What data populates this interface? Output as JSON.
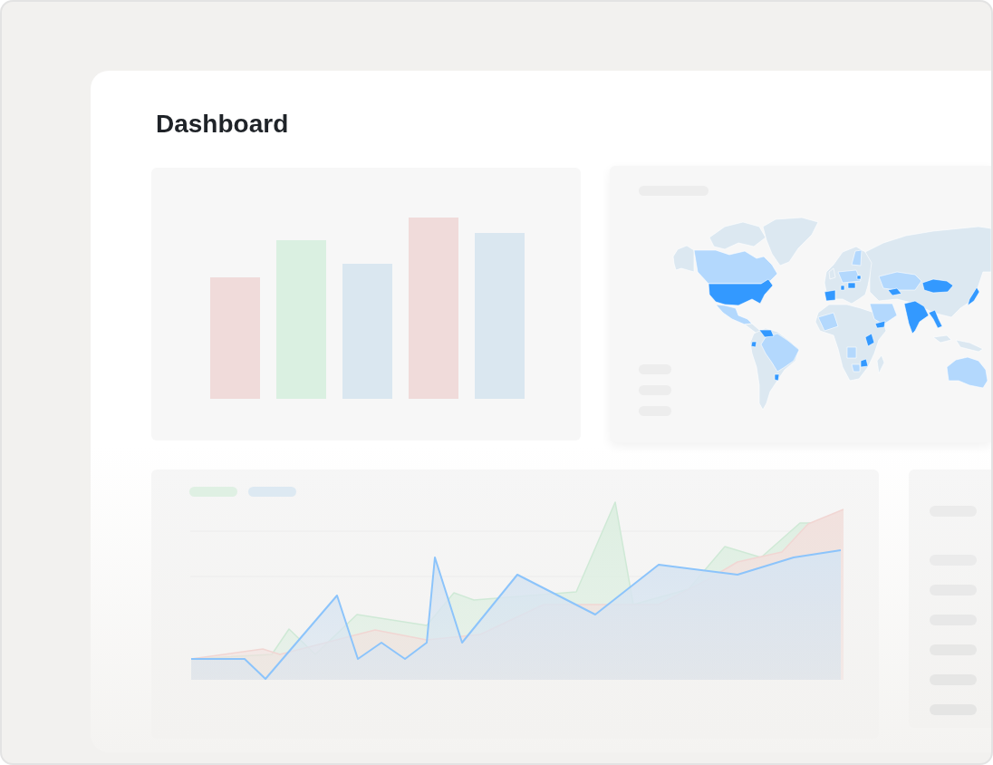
{
  "page": {
    "title": "Dashboard"
  },
  "panels": [
    {
      "kind": "bar_chart"
    },
    {
      "kind": "map"
    },
    {
      "kind": "line_chart"
    },
    {
      "kind": "list"
    }
  ]
}
